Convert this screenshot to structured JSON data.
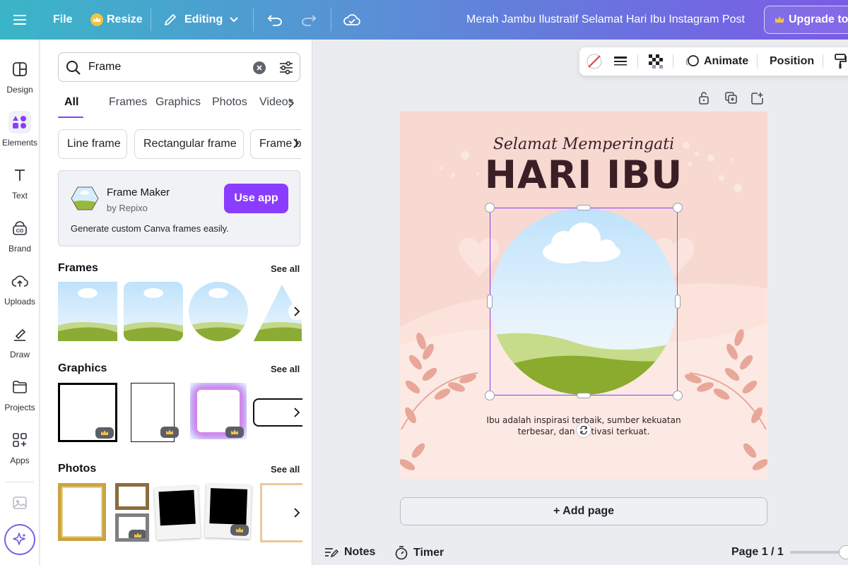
{
  "topbar": {
    "file_label": "File",
    "resize_label": "Resize",
    "editing_label": "Editing",
    "doc_title": "Merah Jambu Ilustratif Selamat Hari Ibu Instagram Post",
    "upgrade_label": "Upgrade to C"
  },
  "rail": {
    "items": [
      {
        "label": "Design",
        "icon": "design-icon"
      },
      {
        "label": "Elements",
        "icon": "elements-icon"
      },
      {
        "label": "Text",
        "icon": "text-icon"
      },
      {
        "label": "Brand",
        "icon": "brand-icon"
      },
      {
        "label": "Uploads",
        "icon": "upload-icon"
      },
      {
        "label": "Draw",
        "icon": "draw-icon"
      },
      {
        "label": "Projects",
        "icon": "folder-icon"
      },
      {
        "label": "Apps",
        "icon": "apps-icon"
      }
    ]
  },
  "panel": {
    "search_value": "Frame",
    "tabs": [
      "All",
      "Frames",
      "Graphics",
      "Photos",
      "Videos"
    ],
    "active_tab": "All",
    "chips": [
      "Line frame",
      "Rectangular frame",
      "Frame b"
    ],
    "app_card": {
      "name": "Frame Maker",
      "by": "by Repixo",
      "button": "Use app",
      "description": "Generate custom Canva frames easily."
    },
    "sections": {
      "frames": "Frames",
      "graphics": "Graphics",
      "photos": "Photos",
      "see_all": "See all"
    }
  },
  "toolbar": {
    "animate_label": "Animate",
    "position_label": "Position"
  },
  "design": {
    "script_title": "Selamat Memperingati",
    "main_title": "HARI IBU",
    "body_line1": "Ibu adalah inspirasi terbaik, sumber kekuatan",
    "body_line2": "terbesar, dan motivasi terkuat."
  },
  "canvas": {
    "add_page_label": "+ Add page"
  },
  "bottombar": {
    "notes_label": "Notes",
    "timer_label": "Timer",
    "page_label": "Page 1 / 1"
  },
  "colors": {
    "accent": "#8b3dff",
    "design_bg": "#f7d9d1",
    "title_color": "#3b1f26"
  }
}
